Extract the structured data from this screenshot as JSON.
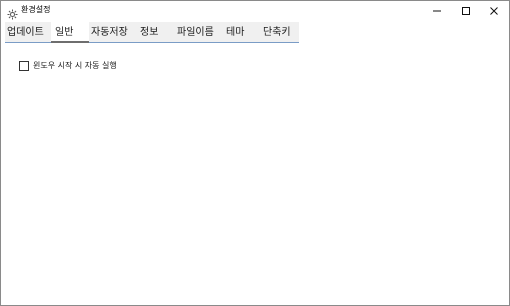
{
  "window": {
    "title": "환경설정",
    "icon": "gear-icon",
    "controls": {
      "minimize_icon": "minimize-icon",
      "maximize_icon": "maximize-icon",
      "close_icon": "close-icon"
    }
  },
  "tabs": [
    {
      "label": "업데이트",
      "selected": false
    },
    {
      "label": "일반",
      "selected": true
    },
    {
      "label": "자동저장",
      "selected": false
    },
    {
      "label": "정보",
      "selected": false
    },
    {
      "label": "파일이름",
      "selected": false
    },
    {
      "label": "테마",
      "selected": false
    },
    {
      "label": "단축키",
      "selected": false
    }
  ],
  "general": {
    "startup_option": {
      "label": "윈도우 시작 시 자동 실행",
      "checked": false
    }
  },
  "colors": {
    "active_tab_underline": "#6e6e6e",
    "tab_strip_background": "#f0f0f0"
  }
}
